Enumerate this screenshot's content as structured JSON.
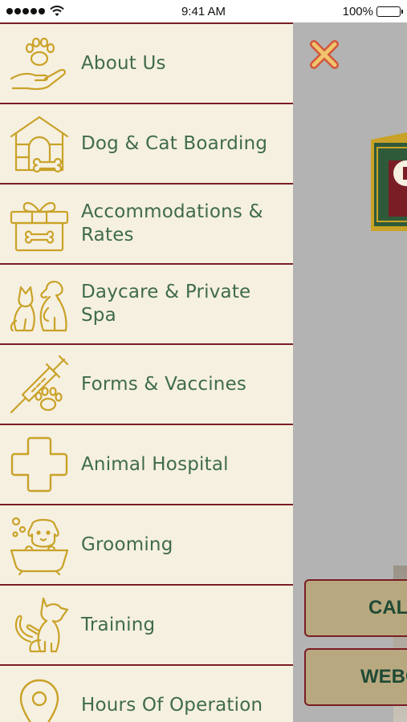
{
  "status_bar": {
    "time": "9:41 AM",
    "battery": "100%"
  },
  "menu": {
    "items": [
      {
        "label": "About Us",
        "icon": "paw-hand-icon"
      },
      {
        "label": "Dog & Cat Boarding",
        "icon": "dog-house-icon"
      },
      {
        "label": "Accommodations & Rates",
        "icon": "gift-box-icon"
      },
      {
        "label": "Daycare & Private Spa",
        "icon": "dog-cat-icon"
      },
      {
        "label": "Forms & Vaccines",
        "icon": "syringe-paw-icon"
      },
      {
        "label": "Animal Hospital",
        "icon": "medical-cross-icon"
      },
      {
        "label": "Grooming",
        "icon": "dog-bath-icon"
      },
      {
        "label": "Training",
        "icon": "dog-trick-icon"
      },
      {
        "label": "Hours Of Operation",
        "icon": "location-pin-icon"
      }
    ]
  },
  "background": {
    "call_button_label": "CALL",
    "webcam_button_label": "WEBCA"
  },
  "colors": {
    "drawer_background": "#f6f0e1",
    "divider": "#7a1d24",
    "menu_text": "#3f6b4b",
    "icon_gold": "#c9a227",
    "overlay_gray": "#b3b3b3",
    "close_icon": "#d1573b"
  }
}
